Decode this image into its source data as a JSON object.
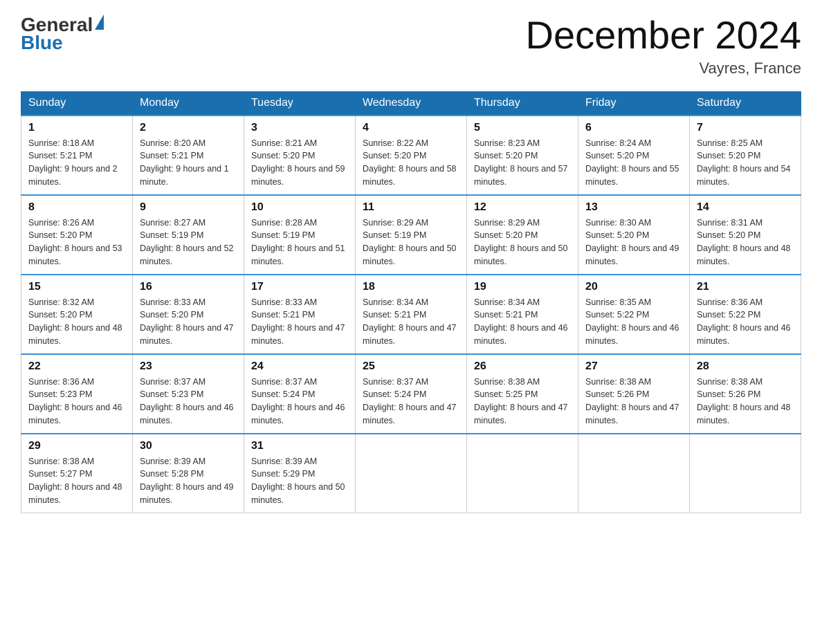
{
  "header": {
    "logo_general": "General",
    "logo_blue": "Blue",
    "month_title": "December 2024",
    "location": "Vayres, France"
  },
  "calendar": {
    "days_of_week": [
      "Sunday",
      "Monday",
      "Tuesday",
      "Wednesday",
      "Thursday",
      "Friday",
      "Saturday"
    ],
    "weeks": [
      [
        {
          "day": "1",
          "sunrise": "8:18 AM",
          "sunset": "5:21 PM",
          "daylight": "9 hours and 2 minutes."
        },
        {
          "day": "2",
          "sunrise": "8:20 AM",
          "sunset": "5:21 PM",
          "daylight": "9 hours and 1 minute."
        },
        {
          "day": "3",
          "sunrise": "8:21 AM",
          "sunset": "5:20 PM",
          "daylight": "8 hours and 59 minutes."
        },
        {
          "day": "4",
          "sunrise": "8:22 AM",
          "sunset": "5:20 PM",
          "daylight": "8 hours and 58 minutes."
        },
        {
          "day": "5",
          "sunrise": "8:23 AM",
          "sunset": "5:20 PM",
          "daylight": "8 hours and 57 minutes."
        },
        {
          "day": "6",
          "sunrise": "8:24 AM",
          "sunset": "5:20 PM",
          "daylight": "8 hours and 55 minutes."
        },
        {
          "day": "7",
          "sunrise": "8:25 AM",
          "sunset": "5:20 PM",
          "daylight": "8 hours and 54 minutes."
        }
      ],
      [
        {
          "day": "8",
          "sunrise": "8:26 AM",
          "sunset": "5:20 PM",
          "daylight": "8 hours and 53 minutes."
        },
        {
          "day": "9",
          "sunrise": "8:27 AM",
          "sunset": "5:19 PM",
          "daylight": "8 hours and 52 minutes."
        },
        {
          "day": "10",
          "sunrise": "8:28 AM",
          "sunset": "5:19 PM",
          "daylight": "8 hours and 51 minutes."
        },
        {
          "day": "11",
          "sunrise": "8:29 AM",
          "sunset": "5:19 PM",
          "daylight": "8 hours and 50 minutes."
        },
        {
          "day": "12",
          "sunrise": "8:29 AM",
          "sunset": "5:20 PM",
          "daylight": "8 hours and 50 minutes."
        },
        {
          "day": "13",
          "sunrise": "8:30 AM",
          "sunset": "5:20 PM",
          "daylight": "8 hours and 49 minutes."
        },
        {
          "day": "14",
          "sunrise": "8:31 AM",
          "sunset": "5:20 PM",
          "daylight": "8 hours and 48 minutes."
        }
      ],
      [
        {
          "day": "15",
          "sunrise": "8:32 AM",
          "sunset": "5:20 PM",
          "daylight": "8 hours and 48 minutes."
        },
        {
          "day": "16",
          "sunrise": "8:33 AM",
          "sunset": "5:20 PM",
          "daylight": "8 hours and 47 minutes."
        },
        {
          "day": "17",
          "sunrise": "8:33 AM",
          "sunset": "5:21 PM",
          "daylight": "8 hours and 47 minutes."
        },
        {
          "day": "18",
          "sunrise": "8:34 AM",
          "sunset": "5:21 PM",
          "daylight": "8 hours and 47 minutes."
        },
        {
          "day": "19",
          "sunrise": "8:34 AM",
          "sunset": "5:21 PM",
          "daylight": "8 hours and 46 minutes."
        },
        {
          "day": "20",
          "sunrise": "8:35 AM",
          "sunset": "5:22 PM",
          "daylight": "8 hours and 46 minutes."
        },
        {
          "day": "21",
          "sunrise": "8:36 AM",
          "sunset": "5:22 PM",
          "daylight": "8 hours and 46 minutes."
        }
      ],
      [
        {
          "day": "22",
          "sunrise": "8:36 AM",
          "sunset": "5:23 PM",
          "daylight": "8 hours and 46 minutes."
        },
        {
          "day": "23",
          "sunrise": "8:37 AM",
          "sunset": "5:23 PM",
          "daylight": "8 hours and 46 minutes."
        },
        {
          "day": "24",
          "sunrise": "8:37 AM",
          "sunset": "5:24 PM",
          "daylight": "8 hours and 46 minutes."
        },
        {
          "day": "25",
          "sunrise": "8:37 AM",
          "sunset": "5:24 PM",
          "daylight": "8 hours and 47 minutes."
        },
        {
          "day": "26",
          "sunrise": "8:38 AM",
          "sunset": "5:25 PM",
          "daylight": "8 hours and 47 minutes."
        },
        {
          "day": "27",
          "sunrise": "8:38 AM",
          "sunset": "5:26 PM",
          "daylight": "8 hours and 47 minutes."
        },
        {
          "day": "28",
          "sunrise": "8:38 AM",
          "sunset": "5:26 PM",
          "daylight": "8 hours and 48 minutes."
        }
      ],
      [
        {
          "day": "29",
          "sunrise": "8:38 AM",
          "sunset": "5:27 PM",
          "daylight": "8 hours and 48 minutes."
        },
        {
          "day": "30",
          "sunrise": "8:39 AM",
          "sunset": "5:28 PM",
          "daylight": "8 hours and 49 minutes."
        },
        {
          "day": "31",
          "sunrise": "8:39 AM",
          "sunset": "5:29 PM",
          "daylight": "8 hours and 50 minutes."
        },
        null,
        null,
        null,
        null
      ]
    ]
  }
}
